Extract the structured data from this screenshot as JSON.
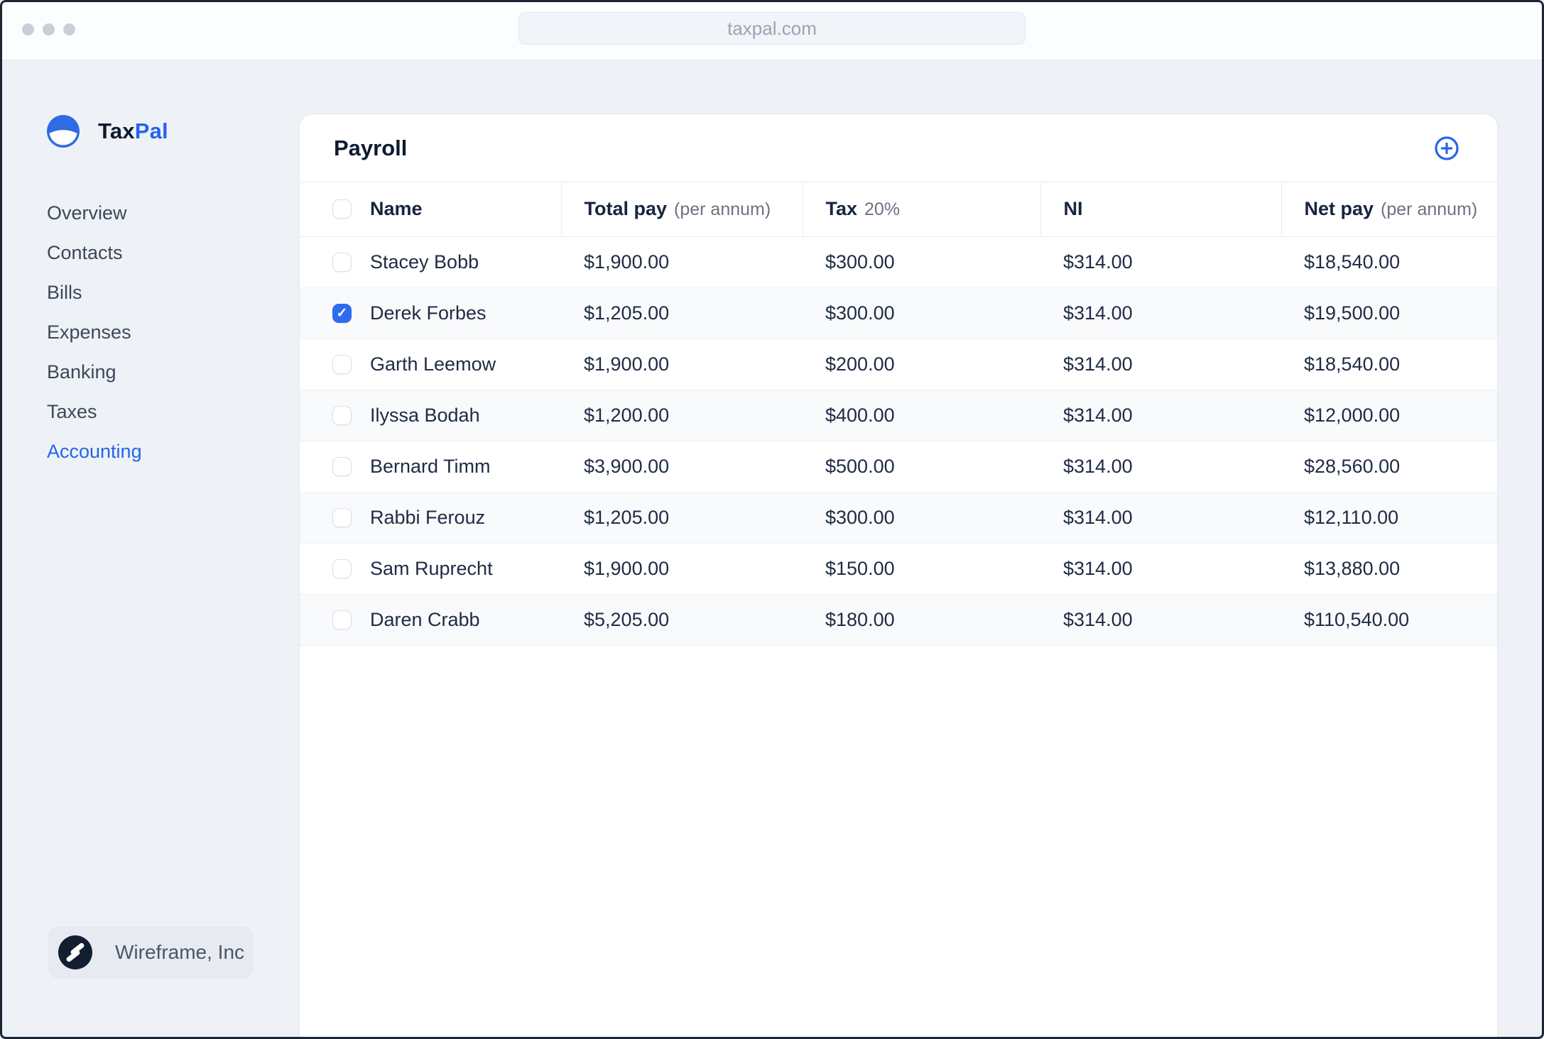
{
  "browser": {
    "url": "taxpal.com"
  },
  "colors": {
    "accent": "#2563eb",
    "checkbox_checked": "#2e6bee",
    "brand_navy": "#0f1b2d",
    "logo_blue": "#2e6be4",
    "page_bg": "#eef2f7"
  },
  "brand": {
    "name_primary": "Tax",
    "name_secondary": "Pal",
    "logo_icon": "taxpal-circle-logo"
  },
  "sidebar": {
    "items": [
      "Overview",
      "Contacts",
      "Bills",
      "Expenses",
      "Banking",
      "Taxes",
      "Accounting"
    ],
    "active_item": "Accounting",
    "footer": {
      "company": "Wireframe, Inc",
      "icon": "wireframe-slash-logo"
    }
  },
  "main": {
    "title": "Payroll",
    "add_button_icon": "plus-circle-icon",
    "table": {
      "headers": [
        {
          "label": "Name",
          "note": ""
        },
        {
          "label": "Total pay",
          "note": "(per annum)"
        },
        {
          "label": "Tax",
          "note": "20%"
        },
        {
          "label": "NI",
          "note": ""
        },
        {
          "label": "Net pay",
          "note": "(per annum)"
        }
      ],
      "rows": [
        {
          "checked": false,
          "name": "Stacey Bobb",
          "total_pay": "$1,900.00",
          "tax": "$300.00",
          "ni": "$314.00",
          "net_pay": "$18,540.00"
        },
        {
          "checked": true,
          "name": "Derek Forbes",
          "total_pay": "$1,205.00",
          "tax": "$300.00",
          "ni": "$314.00",
          "net_pay": "$19,500.00"
        },
        {
          "checked": false,
          "name": "Garth Leemow",
          "total_pay": "$1,900.00",
          "tax": "$200.00",
          "ni": "$314.00",
          "net_pay": "$18,540.00"
        },
        {
          "checked": false,
          "name": "Ilyssa Bodah",
          "total_pay": "$1,200.00",
          "tax": "$400.00",
          "ni": "$314.00",
          "net_pay": "$12,000.00"
        },
        {
          "checked": false,
          "name": "Bernard Timm",
          "total_pay": "$3,900.00",
          "tax": "$500.00",
          "ni": "$314.00",
          "net_pay": "$28,560.00"
        },
        {
          "checked": false,
          "name": "Rabbi Ferouz",
          "total_pay": "$1,205.00",
          "tax": "$300.00",
          "ni": "$314.00",
          "net_pay": "$12,110.00"
        },
        {
          "checked": false,
          "name": "Sam Ruprecht",
          "total_pay": "$1,900.00",
          "tax": "$150.00",
          "ni": "$314.00",
          "net_pay": "$13,880.00"
        },
        {
          "checked": false,
          "name": "Daren Crabb",
          "total_pay": "$5,205.00",
          "tax": "$180.00",
          "ni": "$314.00",
          "net_pay": "$110,540.00"
        }
      ]
    }
  }
}
